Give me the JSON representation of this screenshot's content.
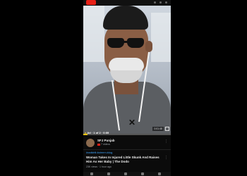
{
  "video": {
    "ad_label": "Ad · 1 of 2 · 0:09",
    "skip_badge": "0:01:48",
    "progress": 0.05,
    "accent_color": "#f5c518"
  },
  "channel": {
    "name": "SFJ Punjab",
    "subscribers": "7 videos",
    "more_icon": "more-vert-icon"
  },
  "next_video": {
    "tags": "#rwdtdrtit #wtrrrrrn #dog",
    "title": "Woman Takes In Injured Little Skunk And Raises Him As Her Baby | The Dodo",
    "meta": "23K views · 1 hour ago"
  }
}
